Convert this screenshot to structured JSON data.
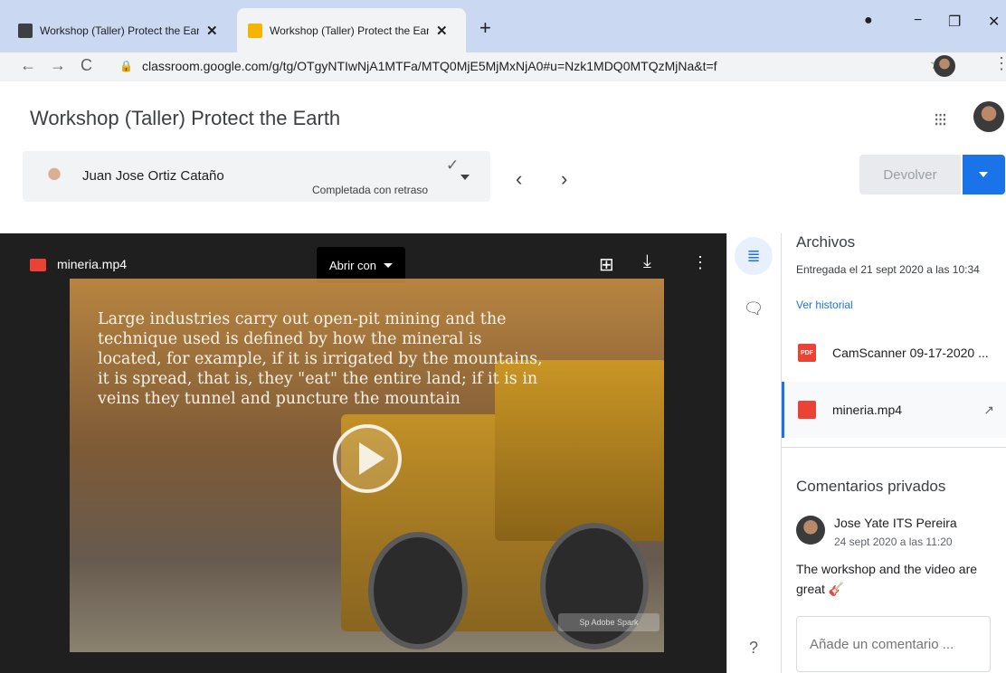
{
  "browser": {
    "tabs": [
      {
        "title": "Workshop (Taller) Protect the Ear",
        "close": "✕"
      },
      {
        "title": "Workshop (Taller) Protect the Ear",
        "close": "✕"
      }
    ],
    "new_tab": "+",
    "url": "classroom.google.com/g/tg/OTgyNTIwNjA1MTFa/MTQ0MjE5MjMxNjA0#u=Nzk1MDQ0MTQzMjNa&t=f",
    "window_controls": {
      "minimize": "−",
      "restore": "❐",
      "close": "✕"
    }
  },
  "header": {
    "title": "Workshop (Taller) Protect the Earth",
    "student": {
      "name": "Juan Jose Ortiz Cataño",
      "status": "Completada con retraso"
    },
    "return_button": "Devolver"
  },
  "viewer": {
    "file_name": "mineria.mp4",
    "open_with": "Abrir con",
    "video_text": "Large industries carry out open-pit mining and the technique used is defined by how the mineral is located, for example, if it is irrigated by the mountains, it is spread, that is, they \"eat\" the entire land; if it is in veins they tunnel and puncture the mountain",
    "watermark": "Sp Adobe Spark"
  },
  "files": {
    "heading": "Archivos",
    "submitted": "Entregada el 21 sept 2020 a las 10:34",
    "history_link": "Ver historial",
    "items": [
      {
        "name": "CamScanner 09-17-2020 ...",
        "icon_label": "PDF"
      },
      {
        "name": "mineria.mp4",
        "icon_label": ""
      }
    ]
  },
  "comments": {
    "heading": "Comentarios privados",
    "author": "Jose Yate ITS Pereira",
    "date": "24 sept 2020 a las 11:20",
    "text": "The workshop and the video are great 🎸",
    "input_placeholder": "Añade un comentario ..."
  },
  "colors": {
    "accent": "#1a73e8",
    "pdf": "#ea4335",
    "video_icon": "#ea4335",
    "tabbar": "#cbd8f1"
  }
}
